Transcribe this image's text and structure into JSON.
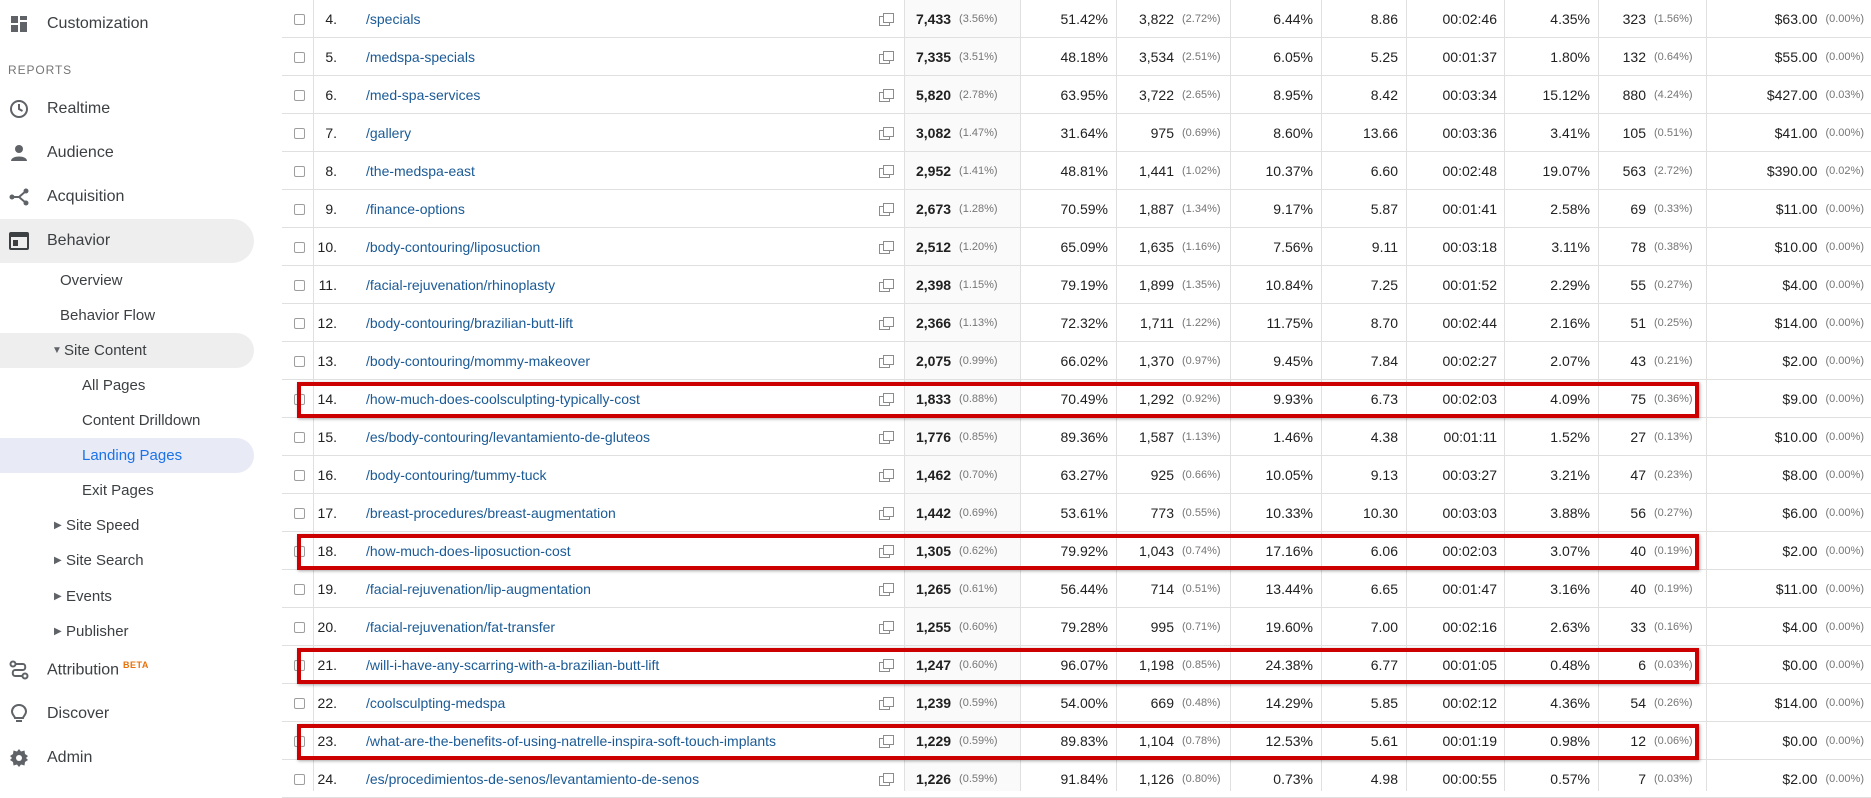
{
  "sidebar": {
    "customization_label": "Customization",
    "reports_header": "REPORTS",
    "realtime_label": "Realtime",
    "audience_label": "Audience",
    "acquisition_label": "Acquisition",
    "behavior_label": "Behavior",
    "behavior_sub": {
      "overview": "Overview",
      "behavior_flow": "Behavior Flow",
      "site_content": "Site Content",
      "all_pages": "All Pages",
      "content_drilldown": "Content Drilldown",
      "landing_pages": "Landing Pages",
      "exit_pages": "Exit Pages",
      "site_speed": "Site Speed",
      "site_search": "Site Search",
      "events": "Events",
      "publisher": "Publisher"
    },
    "attribution_label": "Attribution",
    "attribution_badge": "BETA",
    "discover_label": "Discover",
    "admin_label": "Admin"
  },
  "rows": [
    {
      "idx": "4.",
      "page": "/specials",
      "sessions": "7,433",
      "sessions_pct": "(3.56%)",
      "new_sessions": "51.42%",
      "new_users": "3,822",
      "new_users_pct": "(2.72%)",
      "bounce": "6.44%",
      "pages_session": "8.86",
      "duration": "00:02:46",
      "conv_rate": "4.35%",
      "goals": "323",
      "goals_pct": "(1.56%)",
      "value": "$63.00",
      "value_pct": "(0.00%)",
      "highlighted": false
    },
    {
      "idx": "5.",
      "page": "/medspa-specials",
      "sessions": "7,335",
      "sessions_pct": "(3.51%)",
      "new_sessions": "48.18%",
      "new_users": "3,534",
      "new_users_pct": "(2.51%)",
      "bounce": "6.05%",
      "pages_session": "5.25",
      "duration": "00:01:37",
      "conv_rate": "1.80%",
      "goals": "132",
      "goals_pct": "(0.64%)",
      "value": "$55.00",
      "value_pct": "(0.00%)",
      "highlighted": false
    },
    {
      "idx": "6.",
      "page": "/med-spa-services",
      "sessions": "5,820",
      "sessions_pct": "(2.78%)",
      "new_sessions": "63.95%",
      "new_users": "3,722",
      "new_users_pct": "(2.65%)",
      "bounce": "8.95%",
      "pages_session": "8.42",
      "duration": "00:03:34",
      "conv_rate": "15.12%",
      "goals": "880",
      "goals_pct": "(4.24%)",
      "value": "$427.00",
      "value_pct": "(0.03%)",
      "highlighted": false
    },
    {
      "idx": "7.",
      "page": "/gallery",
      "sessions": "3,082",
      "sessions_pct": "(1.47%)",
      "new_sessions": "31.64%",
      "new_users": "975",
      "new_users_pct": "(0.69%)",
      "bounce": "8.60%",
      "pages_session": "13.66",
      "duration": "00:03:36",
      "conv_rate": "3.41%",
      "goals": "105",
      "goals_pct": "(0.51%)",
      "value": "$41.00",
      "value_pct": "(0.00%)",
      "highlighted": false
    },
    {
      "idx": "8.",
      "page": "/the-medspa-east",
      "sessions": "2,952",
      "sessions_pct": "(1.41%)",
      "new_sessions": "48.81%",
      "new_users": "1,441",
      "new_users_pct": "(1.02%)",
      "bounce": "10.37%",
      "pages_session": "6.60",
      "duration": "00:02:48",
      "conv_rate": "19.07%",
      "goals": "563",
      "goals_pct": "(2.72%)",
      "value": "$390.00",
      "value_pct": "(0.02%)",
      "highlighted": false
    },
    {
      "idx": "9.",
      "page": "/finance-options",
      "sessions": "2,673",
      "sessions_pct": "(1.28%)",
      "new_sessions": "70.59%",
      "new_users": "1,887",
      "new_users_pct": "(1.34%)",
      "bounce": "9.17%",
      "pages_session": "5.87",
      "duration": "00:01:41",
      "conv_rate": "2.58%",
      "goals": "69",
      "goals_pct": "(0.33%)",
      "value": "$11.00",
      "value_pct": "(0.00%)",
      "highlighted": false
    },
    {
      "idx": "10.",
      "page": "/body-contouring/liposuction",
      "sessions": "2,512",
      "sessions_pct": "(1.20%)",
      "new_sessions": "65.09%",
      "new_users": "1,635",
      "new_users_pct": "(1.16%)",
      "bounce": "7.56%",
      "pages_session": "9.11",
      "duration": "00:03:18",
      "conv_rate": "3.11%",
      "goals": "78",
      "goals_pct": "(0.38%)",
      "value": "$10.00",
      "value_pct": "(0.00%)",
      "highlighted": false
    },
    {
      "idx": "11.",
      "page": "/facial-rejuvenation/rhinoplasty",
      "sessions": "2,398",
      "sessions_pct": "(1.15%)",
      "new_sessions": "79.19%",
      "new_users": "1,899",
      "new_users_pct": "(1.35%)",
      "bounce": "10.84%",
      "pages_session": "7.25",
      "duration": "00:01:52",
      "conv_rate": "2.29%",
      "goals": "55",
      "goals_pct": "(0.27%)",
      "value": "$4.00",
      "value_pct": "(0.00%)",
      "highlighted": false
    },
    {
      "idx": "12.",
      "page": "/body-contouring/brazilian-butt-lift",
      "sessions": "2,366",
      "sessions_pct": "(1.13%)",
      "new_sessions": "72.32%",
      "new_users": "1,711",
      "new_users_pct": "(1.22%)",
      "bounce": "11.75%",
      "pages_session": "8.70",
      "duration": "00:02:44",
      "conv_rate": "2.16%",
      "goals": "51",
      "goals_pct": "(0.25%)",
      "value": "$14.00",
      "value_pct": "(0.00%)",
      "highlighted": false
    },
    {
      "idx": "13.",
      "page": "/body-contouring/mommy-makeover",
      "sessions": "2,075",
      "sessions_pct": "(0.99%)",
      "new_sessions": "66.02%",
      "new_users": "1,370",
      "new_users_pct": "(0.97%)",
      "bounce": "9.45%",
      "pages_session": "7.84",
      "duration": "00:02:27",
      "conv_rate": "2.07%",
      "goals": "43",
      "goals_pct": "(0.21%)",
      "value": "$2.00",
      "value_pct": "(0.00%)",
      "highlighted": false
    },
    {
      "idx": "14.",
      "page": "/how-much-does-coolsculpting-typically-cost",
      "sessions": "1,833",
      "sessions_pct": "(0.88%)",
      "new_sessions": "70.49%",
      "new_users": "1,292",
      "new_users_pct": "(0.92%)",
      "bounce": "9.93%",
      "pages_session": "6.73",
      "duration": "00:02:03",
      "conv_rate": "4.09%",
      "goals": "75",
      "goals_pct": "(0.36%)",
      "value": "$9.00",
      "value_pct": "(0.00%)",
      "highlighted": true
    },
    {
      "idx": "15.",
      "page": "/es/body-contouring/levantamiento-de-gluteos",
      "sessions": "1,776",
      "sessions_pct": "(0.85%)",
      "new_sessions": "89.36%",
      "new_users": "1,587",
      "new_users_pct": "(1.13%)",
      "bounce": "1.46%",
      "pages_session": "4.38",
      "duration": "00:01:11",
      "conv_rate": "1.52%",
      "goals": "27",
      "goals_pct": "(0.13%)",
      "value": "$10.00",
      "value_pct": "(0.00%)",
      "highlighted": false
    },
    {
      "idx": "16.",
      "page": "/body-contouring/tummy-tuck",
      "sessions": "1,462",
      "sessions_pct": "(0.70%)",
      "new_sessions": "63.27%",
      "new_users": "925",
      "new_users_pct": "(0.66%)",
      "bounce": "10.05%",
      "pages_session": "9.13",
      "duration": "00:03:27",
      "conv_rate": "3.21%",
      "goals": "47",
      "goals_pct": "(0.23%)",
      "value": "$8.00",
      "value_pct": "(0.00%)",
      "highlighted": false
    },
    {
      "idx": "17.",
      "page": "/breast-procedures/breast-augmentation",
      "sessions": "1,442",
      "sessions_pct": "(0.69%)",
      "new_sessions": "53.61%",
      "new_users": "773",
      "new_users_pct": "(0.55%)",
      "bounce": "10.33%",
      "pages_session": "10.30",
      "duration": "00:03:03",
      "conv_rate": "3.88%",
      "goals": "56",
      "goals_pct": "(0.27%)",
      "value": "$6.00",
      "value_pct": "(0.00%)",
      "highlighted": false
    },
    {
      "idx": "18.",
      "page": "/how-much-does-liposuction-cost",
      "sessions": "1,305",
      "sessions_pct": "(0.62%)",
      "new_sessions": "79.92%",
      "new_users": "1,043",
      "new_users_pct": "(0.74%)",
      "bounce": "17.16%",
      "pages_session": "6.06",
      "duration": "00:02:03",
      "conv_rate": "3.07%",
      "goals": "40",
      "goals_pct": "(0.19%)",
      "value": "$2.00",
      "value_pct": "(0.00%)",
      "highlighted": true
    },
    {
      "idx": "19.",
      "page": "/facial-rejuvenation/lip-augmentation",
      "sessions": "1,265",
      "sessions_pct": "(0.61%)",
      "new_sessions": "56.44%",
      "new_users": "714",
      "new_users_pct": "(0.51%)",
      "bounce": "13.44%",
      "pages_session": "6.65",
      "duration": "00:01:47",
      "conv_rate": "3.16%",
      "goals": "40",
      "goals_pct": "(0.19%)",
      "value": "$11.00",
      "value_pct": "(0.00%)",
      "highlighted": false
    },
    {
      "idx": "20.",
      "page": "/facial-rejuvenation/fat-transfer",
      "sessions": "1,255",
      "sessions_pct": "(0.60%)",
      "new_sessions": "79.28%",
      "new_users": "995",
      "new_users_pct": "(0.71%)",
      "bounce": "19.60%",
      "pages_session": "7.00",
      "duration": "00:02:16",
      "conv_rate": "2.63%",
      "goals": "33",
      "goals_pct": "(0.16%)",
      "value": "$4.00",
      "value_pct": "(0.00%)",
      "highlighted": false
    },
    {
      "idx": "21.",
      "page": "/will-i-have-any-scarring-with-a-brazilian-butt-lift",
      "sessions": "1,247",
      "sessions_pct": "(0.60%)",
      "new_sessions": "96.07%",
      "new_users": "1,198",
      "new_users_pct": "(0.85%)",
      "bounce": "24.38%",
      "pages_session": "6.77",
      "duration": "00:01:05",
      "conv_rate": "0.48%",
      "goals": "6",
      "goals_pct": "(0.03%)",
      "value": "$0.00",
      "value_pct": "(0.00%)",
      "highlighted": true
    },
    {
      "idx": "22.",
      "page": "/coolsculpting-medspa",
      "sessions": "1,239",
      "sessions_pct": "(0.59%)",
      "new_sessions": "54.00%",
      "new_users": "669",
      "new_users_pct": "(0.48%)",
      "bounce": "14.29%",
      "pages_session": "5.85",
      "duration": "00:02:12",
      "conv_rate": "4.36%",
      "goals": "54",
      "goals_pct": "(0.26%)",
      "value": "$14.00",
      "value_pct": "(0.00%)",
      "highlighted": false
    },
    {
      "idx": "23.",
      "page": "/what-are-the-benefits-of-using-natrelle-inspira-soft-touch-implants",
      "sessions": "1,229",
      "sessions_pct": "(0.59%)",
      "new_sessions": "89.83%",
      "new_users": "1,104",
      "new_users_pct": "(0.78%)",
      "bounce": "12.53%",
      "pages_session": "5.61",
      "duration": "00:01:19",
      "conv_rate": "0.98%",
      "goals": "12",
      "goals_pct": "(0.06%)",
      "value": "$0.00",
      "value_pct": "(0.00%)",
      "highlighted": true
    },
    {
      "idx": "24.",
      "page": "/es/procedimientos-de-senos/levantamiento-de-senos",
      "sessions": "1,226",
      "sessions_pct": "(0.59%)",
      "new_sessions": "91.84%",
      "new_users": "1,126",
      "new_users_pct": "(0.80%)",
      "bounce": "0.73%",
      "pages_session": "4.98",
      "duration": "00:00:55",
      "conv_rate": "0.57%",
      "goals": "7",
      "goals_pct": "(0.03%)",
      "value": "$2.00",
      "value_pct": "(0.00%)",
      "highlighted": false
    }
  ],
  "colors": {
    "link": "#1a5a96",
    "highlight_border": "#cc0000",
    "selected_nav_blue": "#1a73e8",
    "beta_badge": "#e8710a"
  }
}
